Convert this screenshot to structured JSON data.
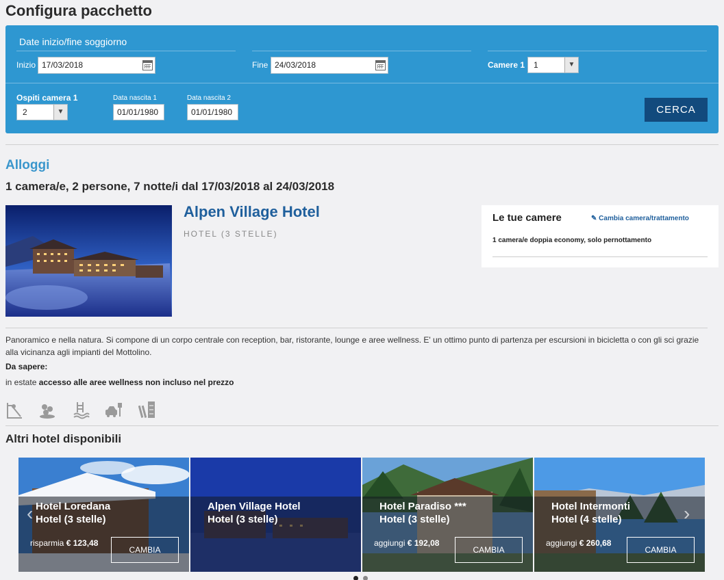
{
  "page": {
    "title": "Configura pacchetto"
  },
  "search": {
    "section_title": "Date inizio/fine soggiorno",
    "start_label": "Inizio",
    "start_value": "17/03/2018",
    "end_label": "Fine",
    "end_value": "24/03/2018",
    "rooms_label": "Camere 1",
    "rooms_value": "1",
    "guests_label": "Ospiti camera 1",
    "guests_value": "2",
    "birth1_label": "Data nascita 1",
    "birth1_value": "01/01/1980",
    "birth2_label": "Data nascita 2",
    "birth2_value": "01/01/1980",
    "search_button": "CERCA"
  },
  "accommodation": {
    "section_title": "Alloggi",
    "summary": "1 camera/e, 2 persone, 7 notte/i dal 17/03/2018 al 24/03/2018",
    "hotel_name": "Alpen Village Hotel",
    "hotel_category": "HOTEL (3 STELLE)",
    "description": "Panoramico e nella natura. Si compone di un corpo centrale con reception, bar, ristorante, lounge e aree wellness. E' un ottimo punto di partenza per escursioni in bicicletta o con gli sci grazie alla vicinanza agli impianti del Mottolino.",
    "know_label": "Da sapere:",
    "know_prefix": "in estate ",
    "know_bold": "accesso alle aree wellness non incluso nel prezzo",
    "amenities": [
      "playground-icon",
      "spa-icon",
      "pool-icon",
      "parking-icon",
      "ski-storage-icon"
    ]
  },
  "rooms": {
    "title": "Le tue camere",
    "change_link": "Cambia camera/trattamento",
    "description": "1 camera/e doppia economy, solo pernottamento"
  },
  "others": {
    "title": "Altri hotel disponibili",
    "cards": [
      {
        "name": "Hotel Loredana Hotel (3 stelle)",
        "price_prefix": "risparmia",
        "price": "€ 123,48",
        "button": "CAMBIA"
      },
      {
        "name": "Alpen Village Hotel Hotel (3 stelle)",
        "price_prefix": "",
        "price": "",
        "button": ""
      },
      {
        "name": "Hotel Paradiso *** Hotel (3 stelle)",
        "price_prefix": "aggiungi",
        "price": "€ 192,08",
        "button": "CAMBIA"
      },
      {
        "name": "Hotel Intermonti Hotel (4 stelle)",
        "price_prefix": "aggiungi",
        "price": "€ 260,68",
        "button": "CAMBIA"
      }
    ]
  },
  "colors": {
    "panel": "#2e97d1",
    "button": "#124a7d",
    "accent": "#3a96cc",
    "link": "#1f5f9c"
  }
}
